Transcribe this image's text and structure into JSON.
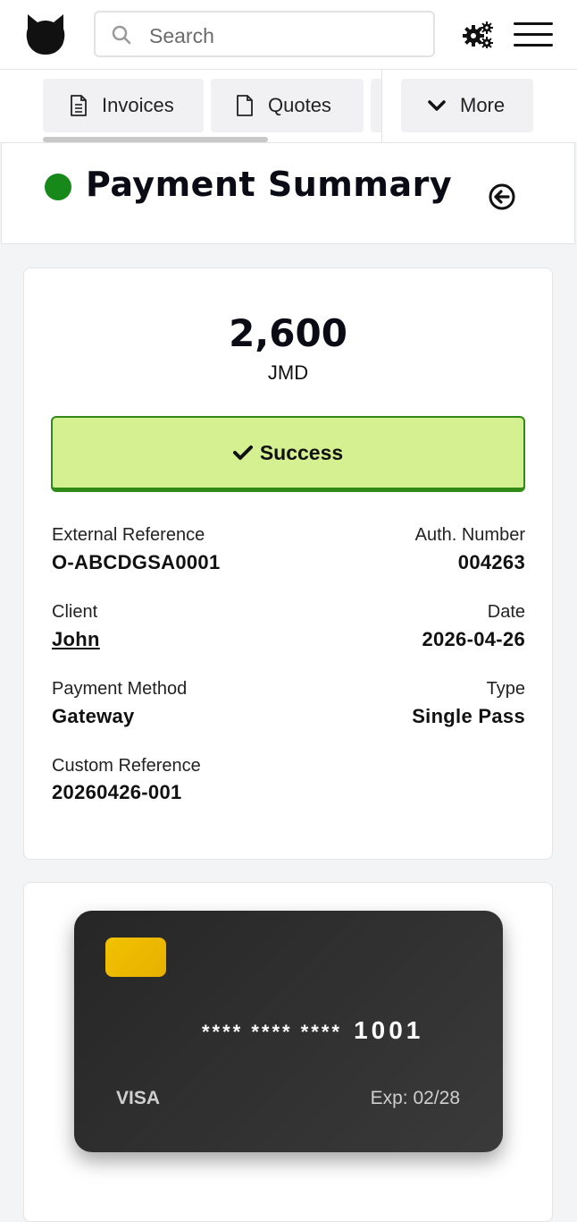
{
  "search": {
    "placeholder": "Search"
  },
  "tabs": [
    {
      "label": "Invoices",
      "icon": "document-lines-icon"
    },
    {
      "label": "Quotes",
      "icon": "document-icon"
    },
    {
      "label": "More",
      "icon": "chevron-down-icon"
    }
  ],
  "header": {
    "title": "Payment Summary",
    "status_color": "#16891a"
  },
  "summary": {
    "amount": "2,600",
    "currency": "JMD",
    "status": "Success",
    "status_bg": "#d4f090",
    "fields": {
      "external_reference_label": "External Reference",
      "external_reference": "O-ABCDGSA0001",
      "auth_number_label": "Auth. Number",
      "auth_number": "004263",
      "client_label": "Client",
      "client": "John",
      "date_label": "Date",
      "date": "2026-04-26",
      "payment_method_label": "Payment Method",
      "payment_method": "Gateway",
      "type_label": "Type",
      "type": "Single Pass",
      "custom_reference_label": "Custom Reference",
      "custom_reference": "20260426-001"
    }
  },
  "card": {
    "masked": "**** **** ****",
    "last4": "1001",
    "brand": "VISA",
    "expiry": "Exp: 02/28"
  }
}
